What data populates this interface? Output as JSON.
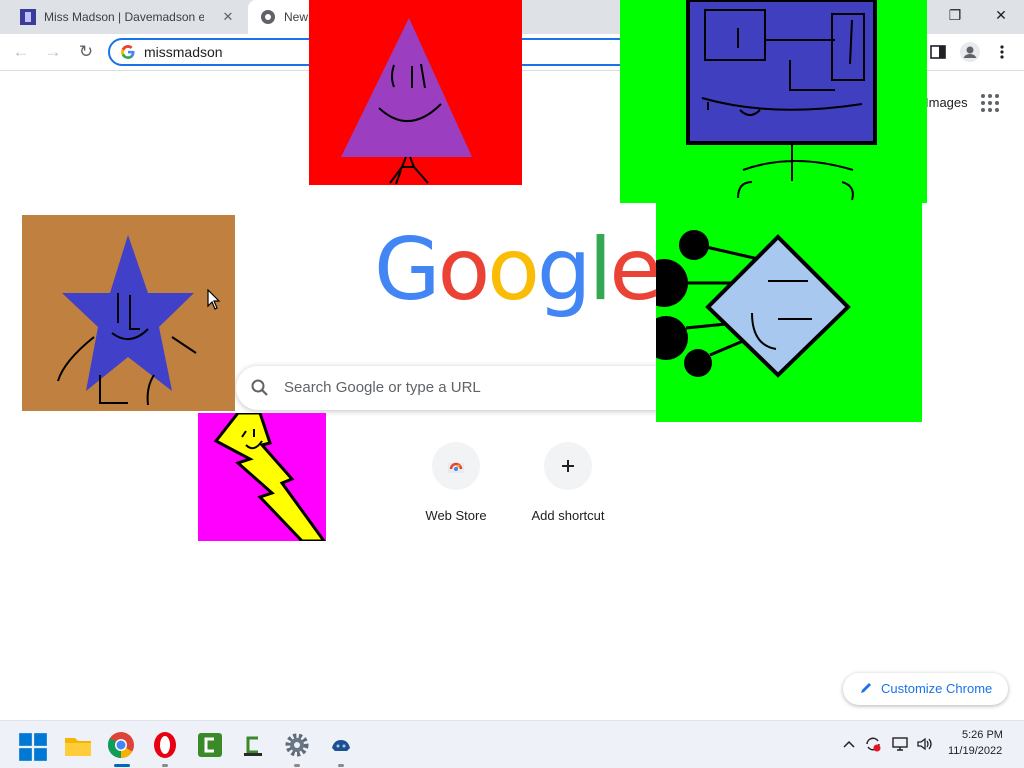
{
  "browser": {
    "tabs": [
      {
        "title": "Miss Madson | Davemadson ente",
        "active": false
      },
      {
        "title": "New Tab",
        "active": true
      }
    ],
    "address_value": "missmadson",
    "controls": {
      "minimize": "—",
      "restore": "❐",
      "close": "✕"
    },
    "nav": {
      "back": "←",
      "forward": "→",
      "reload": "↻"
    }
  },
  "ntp": {
    "images_link": "Images",
    "logo_letters": [
      {
        "ch": "G",
        "color": "#4285f4"
      },
      {
        "ch": "o",
        "color": "#ea4335"
      },
      {
        "ch": "o",
        "color": "#fbbc05"
      },
      {
        "ch": "g",
        "color": "#4285f4"
      },
      {
        "ch": "l",
        "color": "#34a853"
      },
      {
        "ch": "e",
        "color": "#ea4335"
      }
    ],
    "search_placeholder": "Search Google or type a URL",
    "shortcuts": [
      {
        "label": "Web Store",
        "icon": "webstore-icon"
      },
      {
        "label": "Add shortcut",
        "icon": "plus-icon"
      }
    ],
    "customize_label": "Customize Chrome"
  },
  "overlays": [
    {
      "name": "purple-triangle-drawing",
      "bg": "#ff0000"
    },
    {
      "name": "blue-square-drawing",
      "bg": "#00ff00"
    },
    {
      "name": "blue-star-drawing",
      "bg": "#c08040"
    },
    {
      "name": "blue-diamond-drawing",
      "bg": "#00ff00"
    },
    {
      "name": "lightning-bolt-drawing",
      "bg": "#ff00ff"
    }
  ],
  "taskbar": {
    "apps": [
      "start-icon",
      "file-explorer-icon",
      "chrome-icon",
      "opera-icon",
      "camtasia-icon",
      "camtasia-recorder-icon",
      "settings-icon",
      "game-icon"
    ],
    "time": "5:26 PM",
    "date": "11/19/2022"
  }
}
